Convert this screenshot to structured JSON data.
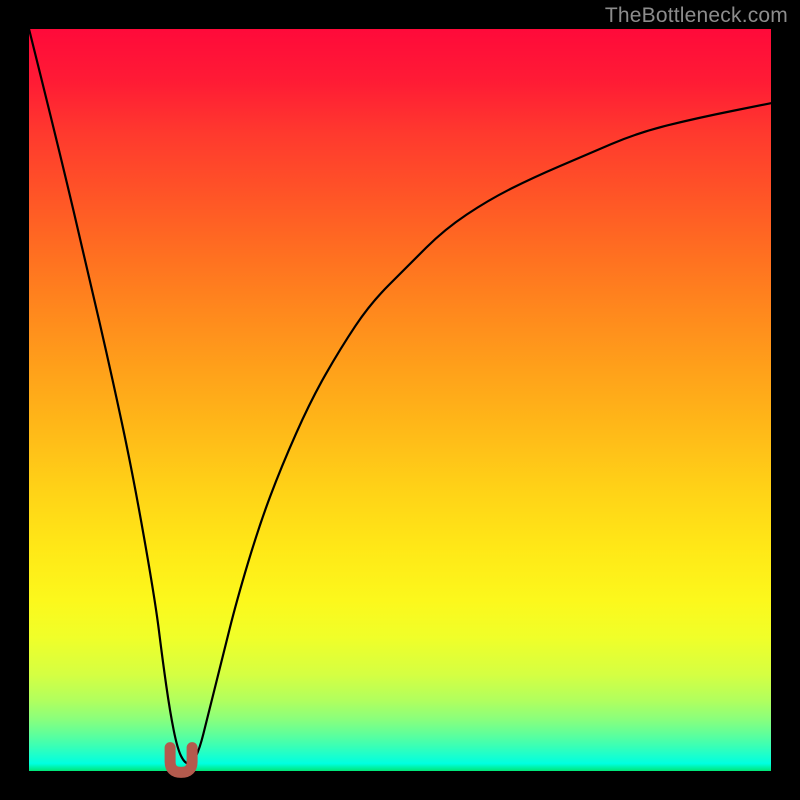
{
  "watermark": "TheBottleneck.com",
  "colors": {
    "background": "#000000",
    "curve": "#000000",
    "marker": "#b35a4d",
    "watermark": "#8c8c8c"
  },
  "chart_data": {
    "type": "line",
    "title": "",
    "xlabel": "",
    "ylabel": "",
    "xlim": [
      0,
      100
    ],
    "ylim": [
      0,
      100
    ],
    "series": [
      {
        "name": "bottleneck-curve",
        "x": [
          0,
          4,
          8,
          11,
          14,
          17,
          18,
          19,
          20,
          21,
          22,
          23,
          24,
          26,
          28,
          31,
          34,
          38,
          42,
          46,
          51,
          56,
          62,
          68,
          75,
          82,
          90,
          100
        ],
        "values": [
          100,
          84,
          67,
          54,
          40,
          23,
          15,
          8,
          3,
          1,
          1,
          3,
          7,
          15,
          23,
          33,
          41,
          50,
          57,
          63,
          68,
          73,
          77,
          80,
          83,
          86,
          88,
          90
        ]
      }
    ],
    "marker": {
      "name": "optimal-point",
      "x": 20.5,
      "y": 1,
      "shape": "u"
    },
    "grid": false,
    "legend": false
  }
}
